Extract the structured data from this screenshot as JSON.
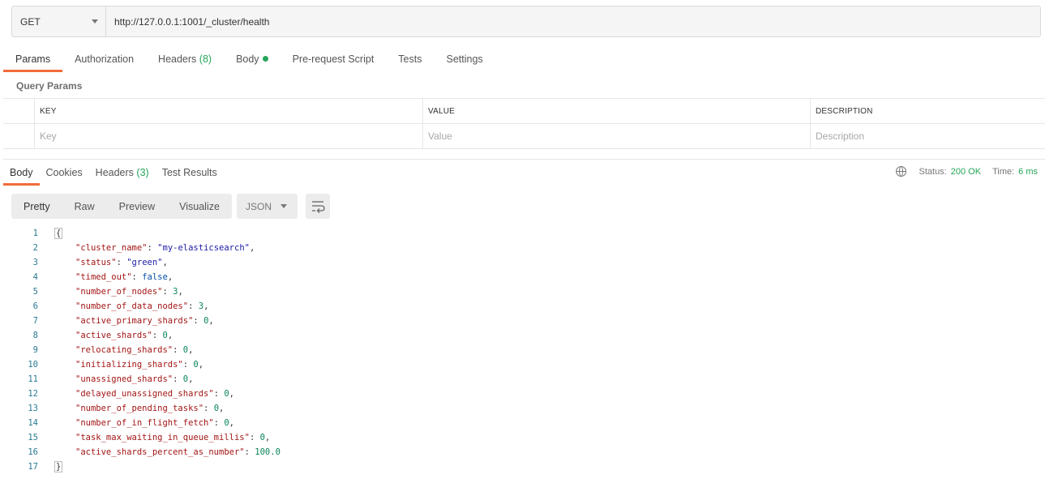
{
  "request": {
    "method": "GET",
    "url": "http://127.0.0.1:1001/_cluster/health"
  },
  "request_tabs": [
    {
      "label": "Params",
      "active": true
    },
    {
      "label": "Authorization"
    },
    {
      "label": "Headers",
      "count": "(8)"
    },
    {
      "label": "Body",
      "dot": true
    },
    {
      "label": "Pre-request Script"
    },
    {
      "label": "Tests"
    },
    {
      "label": "Settings"
    }
  ],
  "query_params": {
    "title": "Query Params",
    "headers": [
      "KEY",
      "VALUE",
      "DESCRIPTION"
    ],
    "placeholders": {
      "key": "Key",
      "value": "Value",
      "description": "Description"
    }
  },
  "response_tabs": [
    {
      "label": "Body",
      "active": true
    },
    {
      "label": "Cookies"
    },
    {
      "label": "Headers",
      "count": "(3)"
    },
    {
      "label": "Test Results"
    }
  ],
  "response_status": {
    "status_label": "Status:",
    "status_value": "200 OK",
    "time_label": "Time:",
    "time_value": "6 ms"
  },
  "view_modes": [
    "Pretty",
    "Raw",
    "Preview",
    "Visualize"
  ],
  "active_view": "Pretty",
  "format": "JSON",
  "code": {
    "open": "{",
    "close": "}",
    "entries": [
      {
        "key": "\"cluster_name\"",
        "value": "\"my-elasticsearch\"",
        "type": "s"
      },
      {
        "key": "\"status\"",
        "value": "\"green\"",
        "type": "s"
      },
      {
        "key": "\"timed_out\"",
        "value": "false",
        "type": "b"
      },
      {
        "key": "\"number_of_nodes\"",
        "value": "3",
        "type": "n"
      },
      {
        "key": "\"number_of_data_nodes\"",
        "value": "3",
        "type": "n"
      },
      {
        "key": "\"active_primary_shards\"",
        "value": "0",
        "type": "n"
      },
      {
        "key": "\"active_shards\"",
        "value": "0",
        "type": "n"
      },
      {
        "key": "\"relocating_shards\"",
        "value": "0",
        "type": "n"
      },
      {
        "key": "\"initializing_shards\"",
        "value": "0",
        "type": "n"
      },
      {
        "key": "\"unassigned_shards\"",
        "value": "0",
        "type": "n"
      },
      {
        "key": "\"delayed_unassigned_shards\"",
        "value": "0",
        "type": "n"
      },
      {
        "key": "\"number_of_pending_tasks\"",
        "value": "0",
        "type": "n"
      },
      {
        "key": "\"number_of_in_flight_fetch\"",
        "value": "0",
        "type": "n"
      },
      {
        "key": "\"task_max_waiting_in_queue_millis\"",
        "value": "0",
        "type": "n"
      },
      {
        "key": "\"active_shards_percent_as_number\"",
        "value": "100.0",
        "type": "n"
      }
    ]
  }
}
